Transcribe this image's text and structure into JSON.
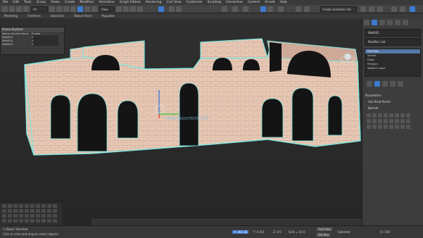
{
  "menu": [
    "File",
    "Edit",
    "Tools",
    "Group",
    "Views",
    "Create",
    "Modifiers",
    "Animation",
    "Graph Editors",
    "Rendering",
    "Civil View",
    "Customize",
    "Scripting",
    "Interactive",
    "Content",
    "Arnold",
    "Help"
  ],
  "toolbar": {
    "selection_filter": "All",
    "view_dropdown": "View",
    "named_set": "Create Selection Set"
  },
  "ribbon": [
    "Modeling",
    "Freeform",
    "Selection",
    "Object Paint",
    "Populate"
  ],
  "scene_explorer": {
    "title": "Scene Explorer",
    "rows": [
      [
        "Name (Sorted Ascending)",
        "Frozen"
      ],
      [
        "Wall001",
        "0"
      ],
      [
        "Wall002",
        "0"
      ],
      [
        "Wall003",
        "0"
      ]
    ]
  },
  "watermark": "WWW.ARQUITEKTA.COM",
  "command_panel": {
    "object_field": "Wall001",
    "modifier_list": "Modifier List",
    "stack": [
      "Edit Poly",
      "Vertex",
      "Edge",
      "Polygon",
      "Wall001 base"
    ],
    "selected_index": 0,
    "rollout_title": "Parameters",
    "checkbox_label": "Use Pivot Points",
    "sub_label": "Normal"
  },
  "status": {
    "selected": "1 Object Selected",
    "prompt": "Click or click-and-drag to select objects",
    "x": "X: 262.06",
    "y": "Y: 4.451",
    "z": "Z: 0.0",
    "grid": "Grid = 10.0",
    "auto_key": "Auto Key",
    "set_key": "Set Key",
    "selected_filter": "Selected",
    "frame": "0 / 100"
  },
  "colors": {
    "wall_face": "#e8c8b4",
    "wall_edge": "#7fe7e0",
    "opening": "#141414",
    "accent": "#3d7bd1"
  }
}
